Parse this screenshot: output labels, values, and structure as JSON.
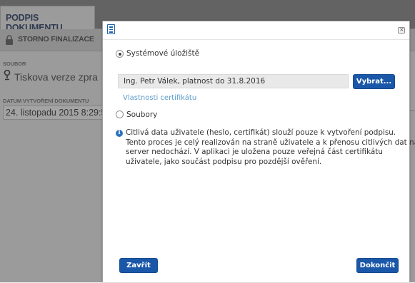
{
  "background": {
    "tab_title": "PODPIS DOKUMENTU",
    "storno_label": "STORNO FINALIZACE",
    "file_label": "SOUBOR",
    "file_value": "Tiskova verze zpra",
    "date_label": "DATUM VYTVOŘENÍ DOKUMENTU",
    "date_value": "24. listopadu 2015 8:29:5"
  },
  "dialog": {
    "option_system_storage": "Systémové úložiště",
    "certificate_value": "Ing. Petr Válek, platnost do 31.8.2016",
    "select_button": "Vybrat...",
    "certificate_properties_link": "Vlastnosti certifikátu",
    "option_files": "Soubory",
    "info_lines": [
      "Citlivá data uživatele (heslo, certifikát) slouží pouze k vytvoření podpisu.",
      "Tento proces je celý realizován na straně uživatele a k přenosu citlivých dat na",
      "server nedochází. V aplikaci je uložena pouze veřejná část certifikátu",
      "uživatele, jako součást podpisu pro pozdější ověření."
    ],
    "close_button": "Zavřít",
    "finish_button": "Dokončit",
    "selected_option": "Systémové úložiště"
  },
  "colors": {
    "primary_button": "#1a57a8",
    "link": "#5b9ccc",
    "info_icon": "#2b72c2"
  },
  "icons": {
    "header_icon": "form-icon",
    "close_icon": "close-icon",
    "info_icon": "info-icon",
    "lock_icon": "lock-icon",
    "file_icon": "signature-pen-icon"
  }
}
